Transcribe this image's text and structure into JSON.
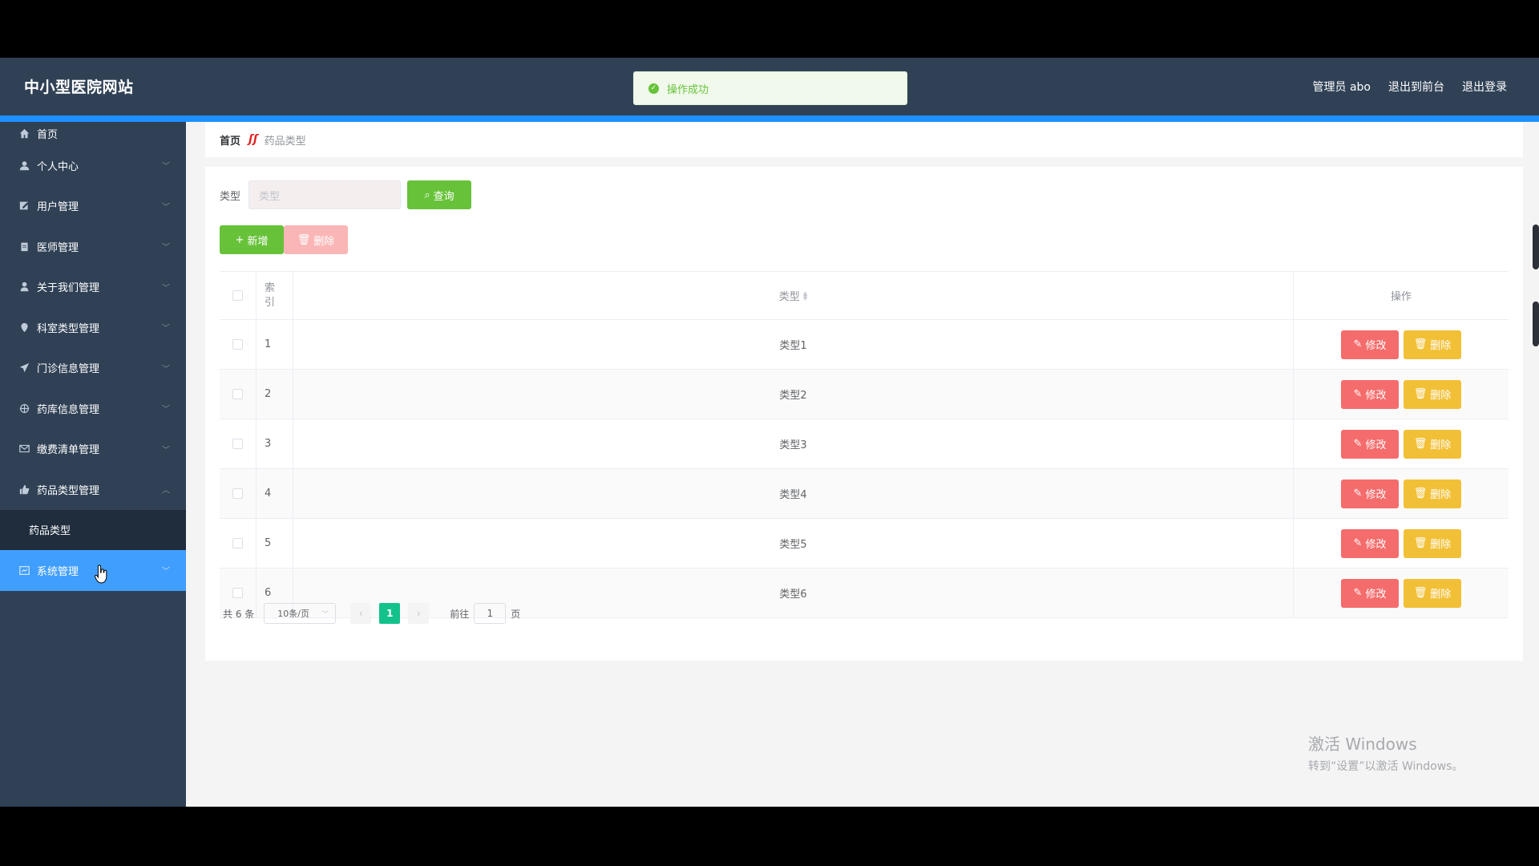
{
  "header": {
    "brand": "中小型医院网站",
    "toast": "操作成功",
    "admin": "管理员 abo",
    "to_front": "退出到前台",
    "logout": "退出登录"
  },
  "sidebar": {
    "items": [
      {
        "label": "首页",
        "icon": "home-icon"
      },
      {
        "label": "个人中心",
        "icon": "user-icon"
      },
      {
        "label": "用户管理",
        "icon": "edit-icon"
      },
      {
        "label": "医师管理",
        "icon": "clipboard-icon"
      },
      {
        "label": "关于我们管理",
        "icon": "person-icon"
      },
      {
        "label": "科室类型管理",
        "icon": "location-icon"
      },
      {
        "label": "门诊信息管理",
        "icon": "send-icon"
      },
      {
        "label": "药库信息管理",
        "icon": "crosshair-icon"
      },
      {
        "label": "缴费清单管理",
        "icon": "mail-icon"
      },
      {
        "label": "药品类型管理",
        "icon": "thumb-icon"
      }
    ],
    "submenu_label": "药品类型",
    "system_label": "系统管理"
  },
  "breadcrumb": {
    "home": "首页",
    "current": "药品类型"
  },
  "search": {
    "label": "类型",
    "placeholder": "类型",
    "button": "查询"
  },
  "actions": {
    "add": "新增",
    "delete": "删除"
  },
  "table": {
    "headers": {
      "index": "索引",
      "type": "类型",
      "op": "操作"
    },
    "rows": [
      {
        "index": "1",
        "type": "类型1"
      },
      {
        "index": "2",
        "type": "类型2"
      },
      {
        "index": "3",
        "type": "类型3"
      },
      {
        "index": "4",
        "type": "类型4"
      },
      {
        "index": "5",
        "type": "类型5"
      },
      {
        "index": "6",
        "type": "类型6"
      }
    ],
    "edit_label": "修改",
    "delete_label": "删除"
  },
  "pagination": {
    "total": "共 6 条",
    "page_size": "10条/页",
    "current_page": "1",
    "goto_prefix": "前往",
    "goto_value": "1",
    "goto_suffix": "页"
  },
  "watermark": {
    "line1": "激活 Windows",
    "line2": "转到“设置”以激活 Windows。"
  },
  "colors": {
    "header_bg": "#304156",
    "accent_blue": "#409eff",
    "success_green": "#67c23a",
    "danger_red": "#f56c6c",
    "warning_yellow": "#f2c037",
    "pager_active": "#13c28b"
  }
}
